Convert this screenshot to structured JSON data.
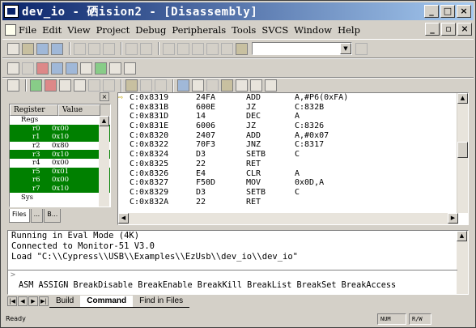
{
  "window": {
    "title": "dev_io  - 硒ision2 - [Disassembly]"
  },
  "menu": [
    "File",
    "Edit",
    "View",
    "Project",
    "Debug",
    "Peripherals",
    "Tools",
    "SVCS",
    "Window",
    "Help"
  ],
  "registers": {
    "headers": [
      "Register",
      "Value"
    ],
    "group_regs": "Regs",
    "rows": [
      {
        "name": "r0",
        "value": "0x00",
        "hl": true
      },
      {
        "name": "r1",
        "value": "0x10",
        "hl": true
      },
      {
        "name": "r2",
        "value": "0x80",
        "hl": false
      },
      {
        "name": "r3",
        "value": "0x10",
        "hl": true
      },
      {
        "name": "r4",
        "value": "0x00",
        "hl": false
      },
      {
        "name": "r5",
        "value": "0x01",
        "hl": true
      },
      {
        "name": "r6",
        "value": "0x00",
        "hl": true
      },
      {
        "name": "r7",
        "value": "0x10",
        "hl": true
      }
    ],
    "group_sys": "Sys",
    "tabs": [
      "Files",
      "...",
      "B..."
    ]
  },
  "disassembly": [
    {
      "addr": "C:0x8319",
      "hex": "24FA",
      "mn": "ADD",
      "op": "A,#P6(0xFA)",
      "cur": true
    },
    {
      "addr": "C:0x831B",
      "hex": "600E",
      "mn": "JZ",
      "op": "C:832B"
    },
    {
      "addr": "C:0x831D",
      "hex": "14",
      "mn": "DEC",
      "op": "A"
    },
    {
      "addr": "C:0x831E",
      "hex": "6006",
      "mn": "JZ",
      "op": "C:8326"
    },
    {
      "addr": "C:0x8320",
      "hex": "2407",
      "mn": "ADD",
      "op": "A,#0x07"
    },
    {
      "addr": "C:0x8322",
      "hex": "70F3",
      "mn": "JNZ",
      "op": "C:8317"
    },
    {
      "addr": "C:0x8324",
      "hex": "D3",
      "mn": "SETB",
      "op": "C"
    },
    {
      "addr": "C:0x8325",
      "hex": "22",
      "mn": "RET",
      "op": ""
    },
    {
      "addr": "C:0x8326",
      "hex": "E4",
      "mn": "CLR",
      "op": "A"
    },
    {
      "addr": "C:0x8327",
      "hex": "F50D",
      "mn": "MOV",
      "op": "0x0D,A"
    },
    {
      "addr": "C:0x8329",
      "hex": "D3",
      "mn": "SETB",
      "op": "C"
    },
    {
      "addr": "C:0x832A",
      "hex": "22",
      "mn": "RET",
      "op": ""
    }
  ],
  "output": {
    "lines": [
      "Running in Eval Mode (4K)",
      "Connected to Monitor-51 V3.0",
      "Load \"C:\\\\Cypress\\\\USB\\\\Examples\\\\EzUsb\\\\dev_io\\\\dev_io\""
    ],
    "prompt": ">",
    "help": "ASM ASSIGN BreakDisable BreakEnable BreakKill BreakList BreakSet BreakAccess",
    "tabs": [
      "Build",
      "Command",
      "Find in Files"
    ]
  },
  "status": {
    "left": "Ready",
    "num": "NUM",
    "rw": "R/W"
  }
}
